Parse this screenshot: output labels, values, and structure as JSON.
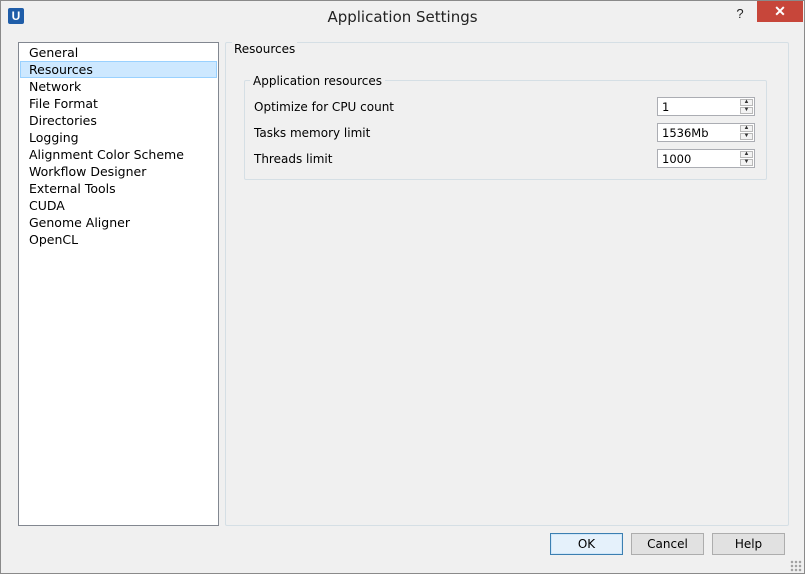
{
  "window": {
    "title": "Application Settings",
    "app_icon_letter": "U",
    "help_glyph": "?",
    "close_glyph": "✕"
  },
  "nav": {
    "items": [
      {
        "label": "General",
        "selected": false
      },
      {
        "label": "Resources",
        "selected": true
      },
      {
        "label": "Network",
        "selected": false
      },
      {
        "label": "File Format",
        "selected": false
      },
      {
        "label": "Directories",
        "selected": false
      },
      {
        "label": "Logging",
        "selected": false
      },
      {
        "label": "Alignment Color Scheme",
        "selected": false
      },
      {
        "label": "Workflow Designer",
        "selected": false
      },
      {
        "label": "External Tools",
        "selected": false
      },
      {
        "label": "CUDA",
        "selected": false
      },
      {
        "label": "Genome Aligner",
        "selected": false
      },
      {
        "label": "OpenCL",
        "selected": false
      }
    ]
  },
  "panel": {
    "title": "Resources",
    "group_title": "Application resources",
    "fields": [
      {
        "label": "Optimize for CPU count",
        "value": "1"
      },
      {
        "label": "Tasks memory limit",
        "value": "1536Mb"
      },
      {
        "label": "Threads limit",
        "value": "1000"
      }
    ]
  },
  "buttons": {
    "ok": "OK",
    "cancel": "Cancel",
    "help": "Help"
  },
  "colors": {
    "selection_bg": "#cde8ff",
    "close_button": "#c7463a"
  },
  "icons": {
    "spin_up": "▲",
    "spin_down": "▼"
  }
}
